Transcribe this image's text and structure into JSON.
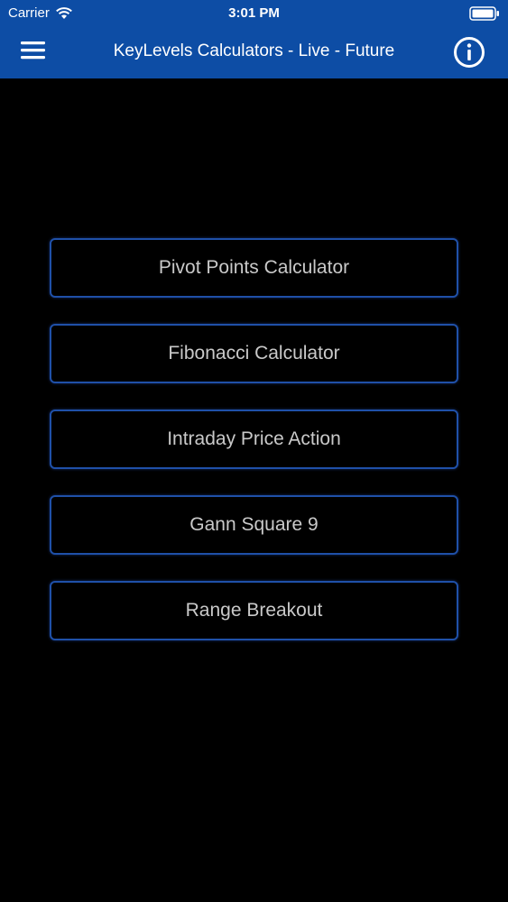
{
  "status_bar": {
    "carrier": "Carrier",
    "time": "3:01 PM",
    "wifi_icon": "wifi-icon",
    "battery_icon": "battery-icon"
  },
  "nav": {
    "title": "KeyLevels Calculators - Live - Future",
    "menu_icon": "hamburger-menu-icon",
    "info_icon": "info-icon"
  },
  "menu": {
    "items": [
      {
        "label": "Pivot Points Calculator"
      },
      {
        "label": "Fibonacci Calculator"
      },
      {
        "label": "Intraday Price Action"
      },
      {
        "label": "Gann Square 9"
      },
      {
        "label": "Range Breakout"
      }
    ]
  },
  "colors": {
    "header_bg": "#0d4da5",
    "page_bg": "#000000",
    "button_border": "#1f50a8",
    "button_text": "#c9c9c9"
  }
}
